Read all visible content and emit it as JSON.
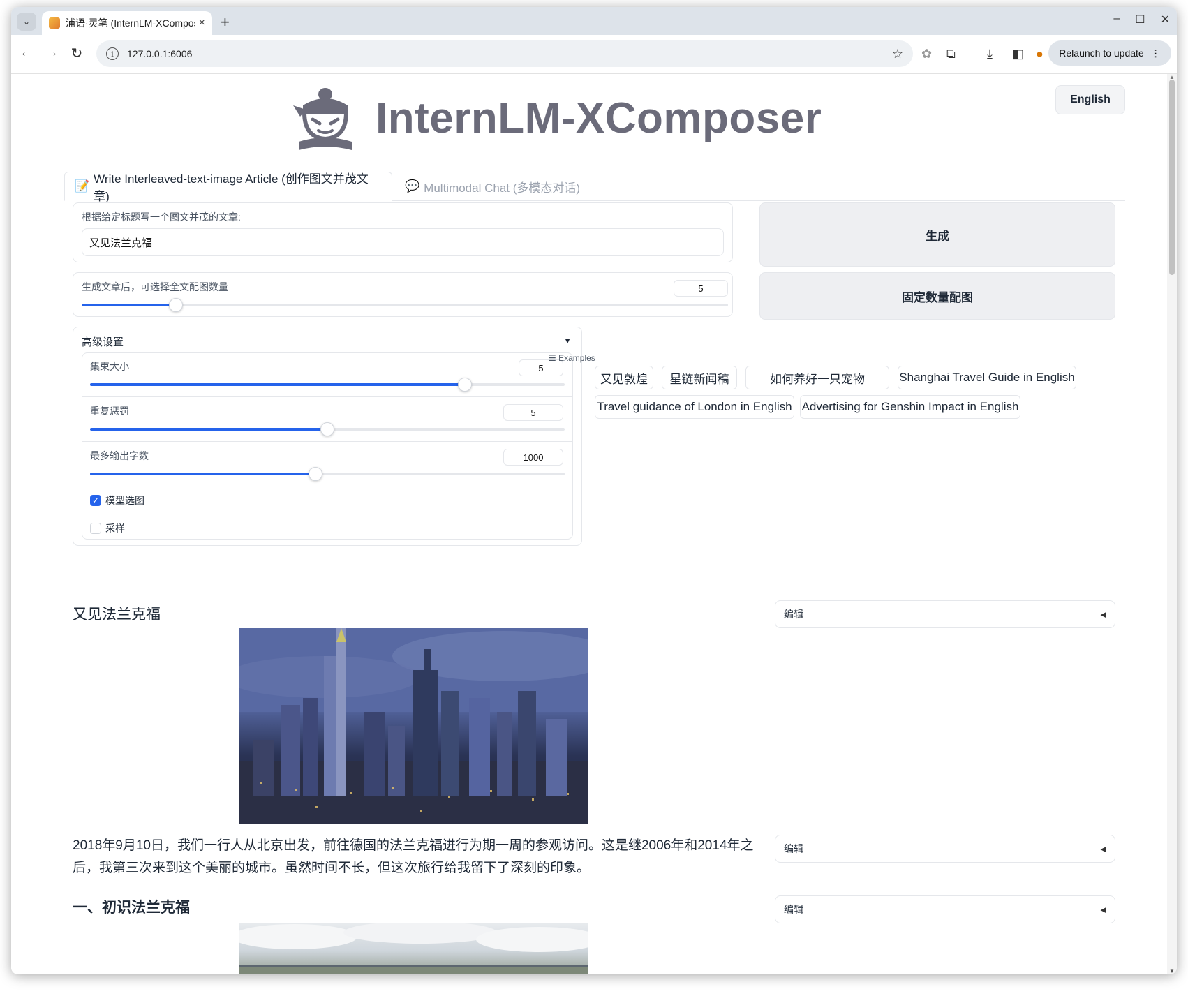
{
  "browser": {
    "tab_title": "浦语·灵笔 (InternLM-XComposer)",
    "url": "127.0.0.1:6006",
    "relaunch_label": "Relaunch to update"
  },
  "header": {
    "logo_title": "InternLM-XComposer",
    "language_button": "English"
  },
  "tabs": [
    {
      "emoji": "📝",
      "label": "Write Interleaved-text-image Article (创作图文并茂文章)"
    },
    {
      "emoji": "💬",
      "label": "Multimodal Chat (多模态对话)"
    }
  ],
  "article_form": {
    "title_label": "根据给定标题写一个图文并茂的文章:",
    "title_value": "又见法兰克福",
    "generate_button": "生成",
    "image_count_label": "生成文章后，可选择全文配图数量",
    "image_count_value": "5",
    "image_count_fraction": 0.146,
    "fixed_images_button": "固定数量配图"
  },
  "advanced": {
    "title": "高级设置",
    "toggle_icon": "▼",
    "beam_label": "集束大小",
    "beam_value": "5",
    "beam_fraction": 0.79,
    "repetition_label": "重复惩罚",
    "repetition_value": "5",
    "repetition_fraction": 0.5,
    "max_tokens_label": "最多输出字数",
    "max_tokens_value": "1000",
    "max_tokens_fraction": 0.475,
    "model_select_label": "模型选图",
    "model_select_checked": true,
    "sampling_label": "采样",
    "sampling_checked": false
  },
  "examples": {
    "label": "Examples",
    "items": [
      "又见敦煌",
      "星链新闻稿",
      "如何养好一只宠物",
      "Shanghai Travel Guide in English",
      "Travel guidance of London in English",
      "Advertising for Genshin Impact in English"
    ]
  },
  "article": {
    "title": "又见法兰克福",
    "paragraph": "2018年9月10日，我们一行人从北京出发，前往德国的法兰克福进行为期一周的参观访问。这是继2006年和2014年之后，我第三次来到这个美丽的城市。虽然时间不长，但这次旅行给我留下了深刻的印象。",
    "section_heading": "一、初识法兰克福",
    "edit_label": "编辑"
  }
}
